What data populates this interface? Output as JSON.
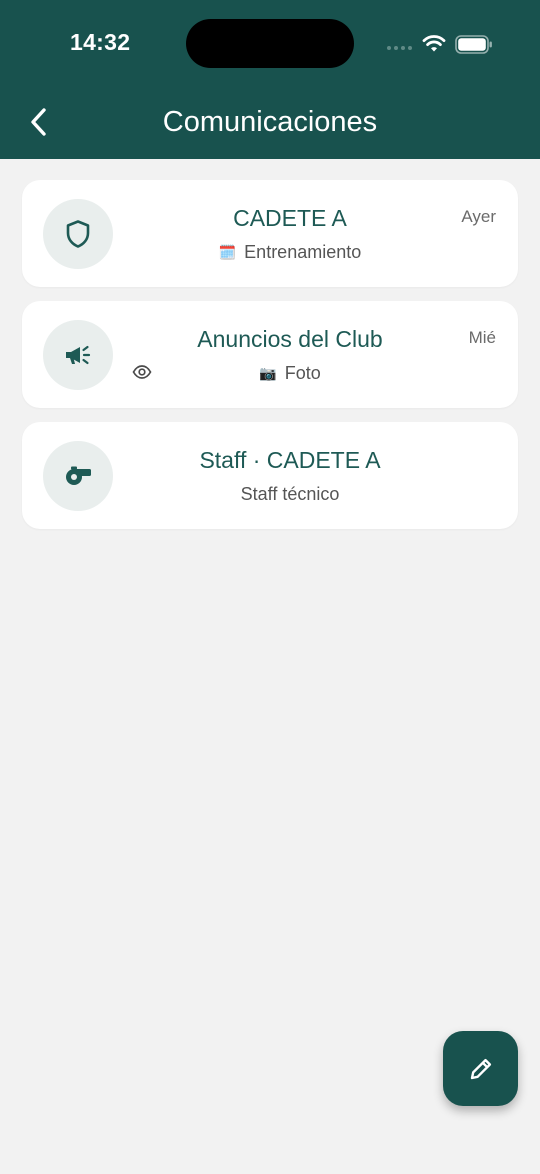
{
  "status_bar": {
    "time": "14:32"
  },
  "header": {
    "title": "Comunicaciones",
    "back_icon": "chevron-left-icon"
  },
  "colors": {
    "primary": "#18524e",
    "title_text": "#1e5a55",
    "background": "#f2f2f2",
    "avatar_bg": "#e9eeed"
  },
  "conversations": [
    {
      "icon": "shield-icon",
      "title": "CADETE A",
      "subtitle_emoji": "🗓️",
      "subtitle": "Entrenamiento",
      "date": "Ayer"
    },
    {
      "icon": "megaphone-icon",
      "title": "Anuncios del Club",
      "subtitle_emoji": "📷",
      "subtitle": "Foto",
      "date": "Mié",
      "seen_icon": "eye-icon"
    },
    {
      "icon": "whistle-icon",
      "title": "Staff · CADETE A",
      "subtitle": "Staff técnico",
      "date": ""
    }
  ],
  "fab": {
    "icon": "pencil-icon"
  }
}
